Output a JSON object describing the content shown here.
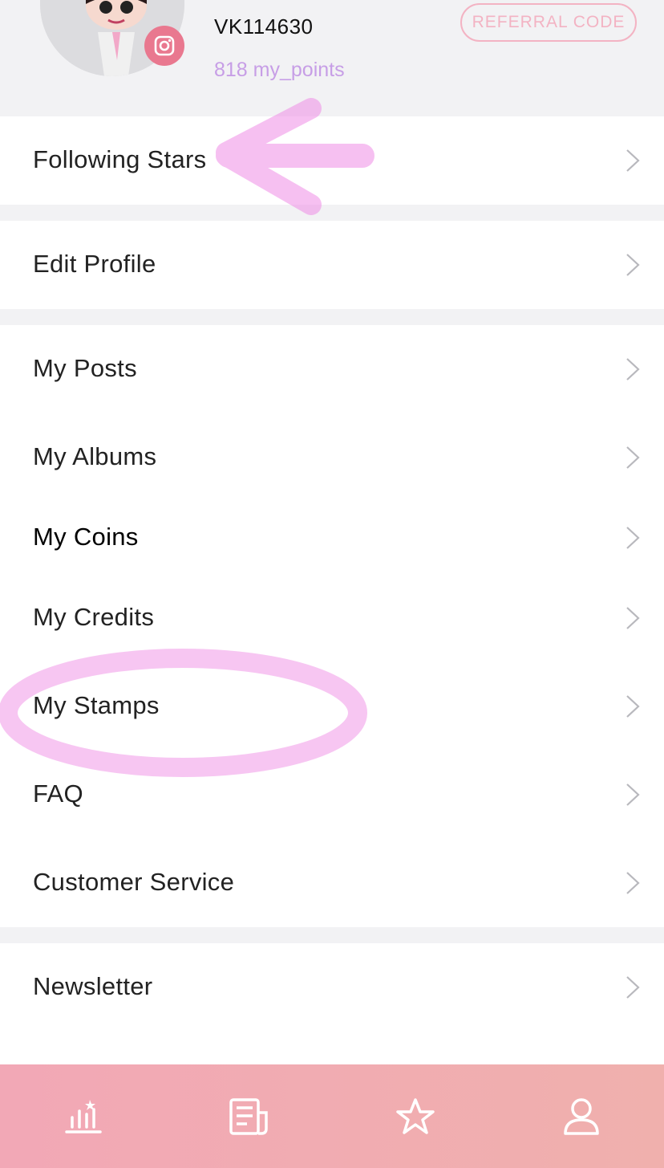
{
  "profile": {
    "username": "VK114630",
    "points": "818 my_points",
    "referral_label": "REFERRAL CODE"
  },
  "sections": [
    {
      "items": [
        {
          "label": "Following Stars"
        }
      ]
    },
    {
      "items": [
        {
          "label": "Edit Profile"
        }
      ]
    },
    {
      "items": [
        {
          "label": "My Posts"
        },
        {
          "label": "My Albums"
        },
        {
          "label": "My Coins"
        },
        {
          "label": "My Credits"
        },
        {
          "label": "My Stamps"
        },
        {
          "label": "FAQ"
        },
        {
          "label": "Customer Service"
        }
      ]
    },
    {
      "items": [
        {
          "label": "Newsletter"
        }
      ]
    }
  ],
  "tabbar": {
    "tabs": [
      {
        "icon": "ranking-chart-icon"
      },
      {
        "icon": "news-icon"
      },
      {
        "icon": "star-icon"
      },
      {
        "icon": "profile-icon"
      }
    ]
  },
  "colors": {
    "accent_pink": "#e9788f",
    "points_purple": "#c79ee6",
    "referral_border": "#f3b3c3",
    "annotation_pink": "#f08ee6",
    "tabbar_start": "#f2a8b6",
    "tabbar_end": "#f0b0ad"
  }
}
